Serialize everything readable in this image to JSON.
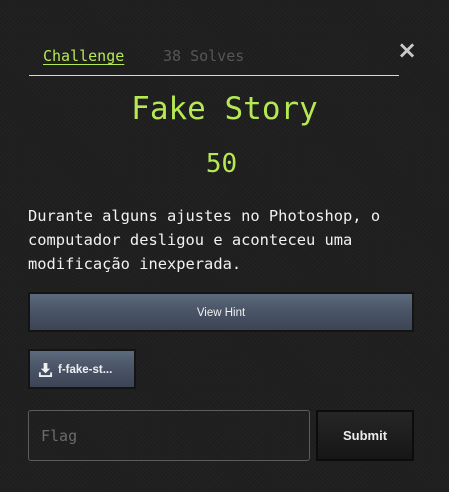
{
  "modal": {
    "close_label": "×",
    "tabs": [
      {
        "label": "Challenge",
        "active": true
      },
      {
        "label": "38 Solves",
        "active": false
      }
    ],
    "title": "Fake Story",
    "points": "50",
    "description": "Durante alguns ajustes no Photoshop, o computador desligou e aconteceu uma modificação inexperada.",
    "hint_button": "View Hint",
    "file_button": {
      "label": "f-fake-st...",
      "icon": "download-icon"
    },
    "flag_input": {
      "placeholder": "Flag",
      "value": ""
    },
    "submit_button": "Submit"
  },
  "colors": {
    "accent": "#b5e853",
    "background": "#1f1f1f",
    "button": "#4a5567",
    "muted_text": "#565656"
  }
}
